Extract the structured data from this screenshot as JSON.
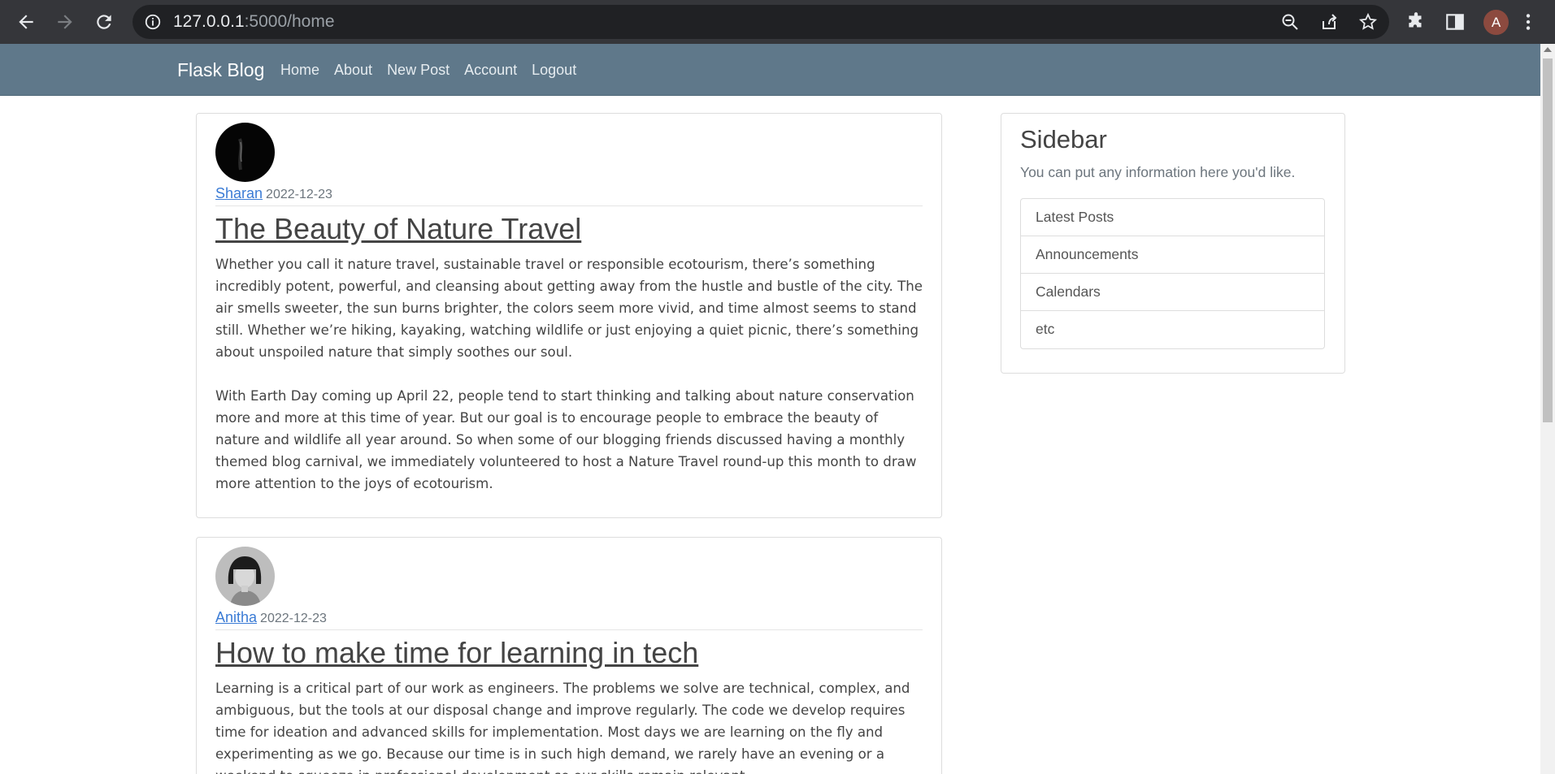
{
  "browser": {
    "url_host": "127.0.0.1",
    "url_path": ":5000/home",
    "profile_initial": "A",
    "icons": [
      "back-arrow-icon",
      "forward-arrow-icon",
      "reload-icon",
      "site-info-icon",
      "zoom-out-icon",
      "share-icon",
      "star-icon",
      "extensions-icon",
      "side-panel-icon",
      "menu-dots-icon"
    ]
  },
  "navbar": {
    "brand": "Flask Blog",
    "links": [
      "Home",
      "About",
      "New Post",
      "Account",
      "Logout"
    ]
  },
  "posts": [
    {
      "author": "Sharan",
      "date": "2022-12-23",
      "title": "The Beauty of Nature Travel",
      "paragraphs": [
        "Whether you call it nature travel, sustainable travel or responsible ecotourism, there’s something incredibly potent, powerful, and cleansing about getting away from the hustle and bustle of the city. The air smells sweeter, the sun burns brighter, the colors seem more vivid, and time almost seems to stand still. Whether we’re hiking, kayaking, watching wildlife or just enjoying a quiet picnic, there’s something about unspoiled nature that simply soothes our soul.",
        "With Earth Day coming up April 22, people tend to start thinking and talking about nature conservation more and more at this time of year. But our goal is to encourage people to embrace the beauty of nature and wildlife all year around. So when some of our blogging friends discussed having a monthly themed blog carnival, we immediately volunteered to host a Nature Travel round-up this month to draw more attention to the joys of ecotourism."
      ]
    },
    {
      "author": "Anitha",
      "date": "2022-12-23",
      "title": "How to make time for learning in tech",
      "paragraphs": [
        "Learning is a critical part of our work as engineers. The problems we solve are technical, complex, and ambiguous, but the tools at our disposal change and improve regularly. The code we develop requires time for ideation and advanced skills for implementation. Most days we are learning on the fly and experimenting as we go. Because our time is in such high demand, we rarely have an evening or a weekend to squeeze in professional development so our skills remain relevant."
      ]
    }
  ],
  "sidebar": {
    "title": "Sidebar",
    "subtitle": "You can put any information here you'd like.",
    "items": [
      "Latest Posts",
      "Announcements",
      "Calendars",
      "etc"
    ]
  }
}
